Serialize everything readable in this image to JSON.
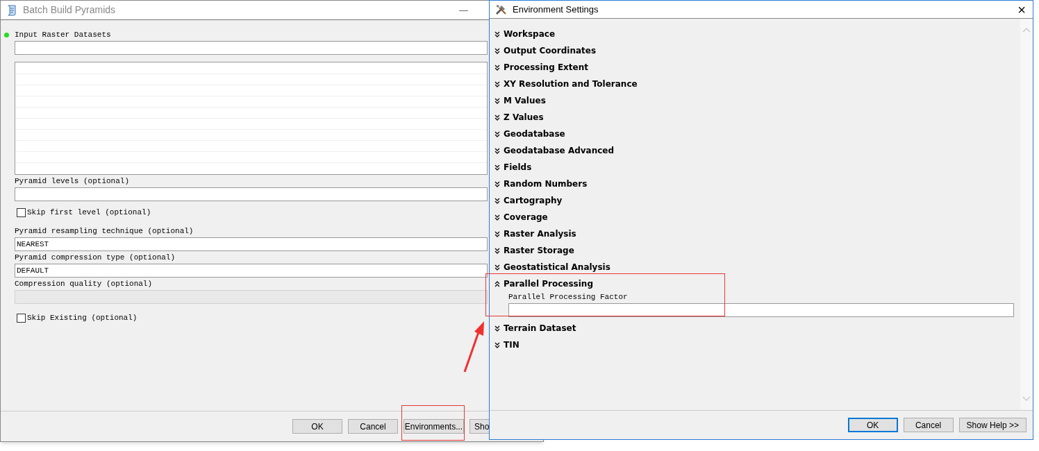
{
  "tool_window": {
    "title": "Batch Build Pyramids",
    "minimize": "—",
    "params": [
      {
        "kind": "field",
        "label": "Input Raster Datasets",
        "required": true,
        "disabled": false
      },
      {
        "kind": "list"
      },
      {
        "kind": "field",
        "label": "Pyramid levels (optional)",
        "required": false,
        "disabled": false
      },
      {
        "kind": "checkbox",
        "label": "Skip first level (optional)",
        "checked": false
      },
      {
        "kind": "field",
        "label": "Pyramid resampling technique (optional)",
        "value": "NEAREST",
        "required": false,
        "disabled": false
      },
      {
        "kind": "field",
        "label": "Pyramid compression type (optional)",
        "value": "DEFAULT",
        "required": false,
        "disabled": false
      },
      {
        "kind": "field",
        "label": "Compression quality (optional)",
        "required": false,
        "disabled": true
      },
      {
        "kind": "checkbox",
        "label": "Skip Existing (optional)",
        "checked": false
      }
    ],
    "buttons": [
      {
        "label": "OK"
      },
      {
        "label": "Cancel"
      },
      {
        "label": "Environments..."
      },
      {
        "label": "Sho"
      }
    ]
  },
  "env_window": {
    "title": "Environment Settings",
    "close": "×",
    "sections": [
      {
        "name": "Workspace",
        "expanded": false
      },
      {
        "name": "Output Coordinates",
        "expanded": false
      },
      {
        "name": "Processing Extent",
        "expanded": false
      },
      {
        "name": "XY Resolution and Tolerance",
        "expanded": false
      },
      {
        "name": "M Values",
        "expanded": false
      },
      {
        "name": "Z Values",
        "expanded": false
      },
      {
        "name": "Geodatabase",
        "expanded": false
      },
      {
        "name": "Geodatabase Advanced",
        "expanded": false
      },
      {
        "name": "Fields",
        "expanded": false
      },
      {
        "name": "Random Numbers",
        "expanded": false
      },
      {
        "name": "Cartography",
        "expanded": false
      },
      {
        "name": "Coverage",
        "expanded": false
      },
      {
        "name": "Raster Analysis",
        "expanded": false
      },
      {
        "name": "Raster Storage",
        "expanded": false
      },
      {
        "name": "Geostatistical Analysis",
        "expanded": false
      },
      {
        "name": "Parallel Processing",
        "expanded": true,
        "fields": [
          {
            "label": "Parallel Processing Factor"
          }
        ]
      },
      {
        "name": "Terrain Dataset",
        "expanded": false
      },
      {
        "name": "TIN",
        "expanded": false
      }
    ],
    "buttons": [
      {
        "label": "OK",
        "default": true
      },
      {
        "label": "Cancel",
        "default": false
      },
      {
        "label": "Show Help >>",
        "default": false
      }
    ]
  }
}
